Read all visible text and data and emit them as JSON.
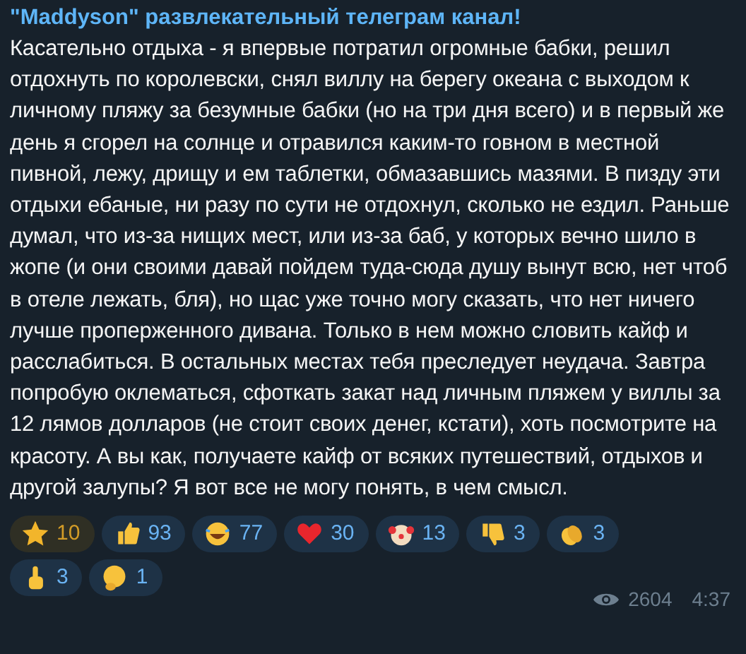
{
  "message": {
    "author": "\"Maddyson\" развлекательный телеграм канал!",
    "text": "Касательно отдыха - я впервые потратил огромные бабки, решил отдохнуть по королевски, снял виллу на берегу океана с выходом к личному пляжу за безумные бабки (но на три дня всего) и в первый же день я сгорел на солнце и отравился каким-то говном в местной пивной, лежу, дрищу и ем таблетки, обмазавшись мазями. В пизду эти отдыхи ебаные, ни разу по сути не отдохнул, сколько не ездил. Раньше думал, что из-за нищих мест, или из-за баб, у которых вечно шило в жопе (и они своими давай пойдем туда-сюда душу вынут всю, нет чтоб в отеле лежать, бля), но щас уже точно могу сказать, что нет ничего лучше проперженного дивана. Только в нем можно словить кайф и расслабиться. В остальных местах тебя преследует неудача. Завтра попробую оклематься, сфоткать закат над личным пляжем у виллы за 12 лямов долларов (не стоит своих денег, кстати), хоть посмотрите на красоту. А вы как, получаете кайф от всяких путешествий, отдыхов и другой залупы? Я вот все не могу понять, в чем смысл.",
    "reactions": [
      {
        "kind": "paid",
        "count": "10"
      },
      {
        "kind": "emoji",
        "count": "93"
      },
      {
        "kind": "emoji",
        "count": "77"
      },
      {
        "kind": "emoji",
        "count": "30"
      },
      {
        "kind": "emoji",
        "count": "13"
      },
      {
        "kind": "emoji",
        "count": "3"
      },
      {
        "kind": "emoji",
        "count": "3"
      },
      {
        "kind": "emoji",
        "count": "3"
      },
      {
        "kind": "emoji",
        "count": "1"
      }
    ],
    "views": "2604",
    "time": "4:37"
  }
}
